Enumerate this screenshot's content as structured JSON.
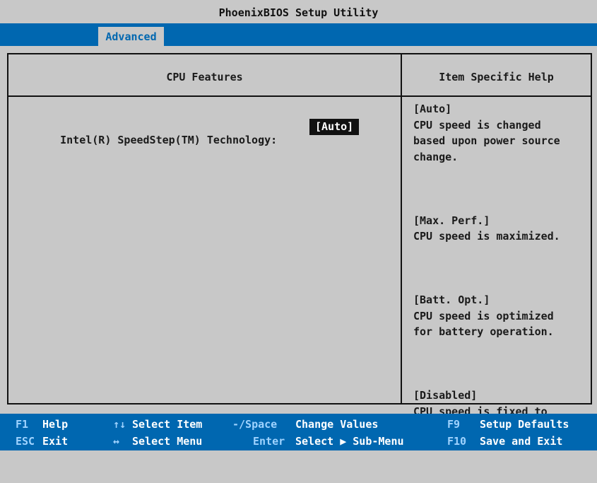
{
  "title": "PhoenixBIOS Setup Utility",
  "menu": {
    "active_tab": "Advanced"
  },
  "panel": {
    "left_header": "CPU Features",
    "right_header": "Item Specific Help"
  },
  "setting": {
    "label": "Intel(R) SpeedStep(TM) Technology:",
    "value": "[Auto]"
  },
  "help": [
    {
      "title": "[Auto]",
      "text": "CPU speed is changed\nbased upon power source\nchange."
    },
    {
      "title": "[Max. Perf.]",
      "text": "CPU speed is maximized."
    },
    {
      "title": "[Batt. Opt.]",
      "text": "CPU speed is optimized\nfor battery operation."
    },
    {
      "title": "[Disabled]",
      "text": "CPU speed is fixed to\nthe battery optimized\nspeed."
    }
  ],
  "status": {
    "row1": [
      {
        "key": "F1",
        "action": "Help"
      },
      {
        "key": "↑↓",
        "action": "Select Item"
      },
      {
        "key": "-/Space",
        "action": "Change Values"
      },
      {
        "key": "F9",
        "action": "Setup Defaults"
      }
    ],
    "row2": [
      {
        "key": "ESC",
        "action": "Exit"
      },
      {
        "key": "↔",
        "action": "Select Menu"
      },
      {
        "key": "Enter",
        "action": "Select ▶ Sub-Menu"
      },
      {
        "key": "F10",
        "action": "Save and Exit"
      }
    ]
  }
}
